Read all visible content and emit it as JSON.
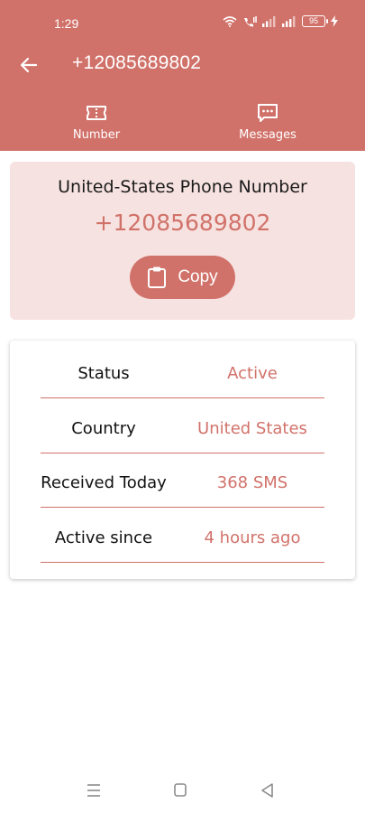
{
  "theme": {
    "brand": "#d1726a",
    "card": "#f6e2e0"
  },
  "status_bar": {
    "time": "1:29",
    "battery": "95"
  },
  "app_bar": {
    "title": "+12085689802",
    "back_icon": "arrow-left-icon"
  },
  "tabs": [
    {
      "label": "Number",
      "icon": "ticket-icon"
    },
    {
      "label": "Messages",
      "icon": "message-dots-icon"
    }
  ],
  "phone_card": {
    "heading": "United-States Phone Number",
    "number": "+12085689802",
    "copy_label": "Copy",
    "copy_icon": "clipboard-icon"
  },
  "info": [
    {
      "label": "Status",
      "value": "Active"
    },
    {
      "label": "Country",
      "value": "United States"
    },
    {
      "label": "Received Today",
      "value": "368 SMS"
    },
    {
      "label": "Active since",
      "value": "4 hours ago"
    }
  ],
  "nav": {
    "menu_icon": "menu-icon",
    "home_icon": "home-square-icon",
    "back_icon": "back-triangle-icon"
  }
}
